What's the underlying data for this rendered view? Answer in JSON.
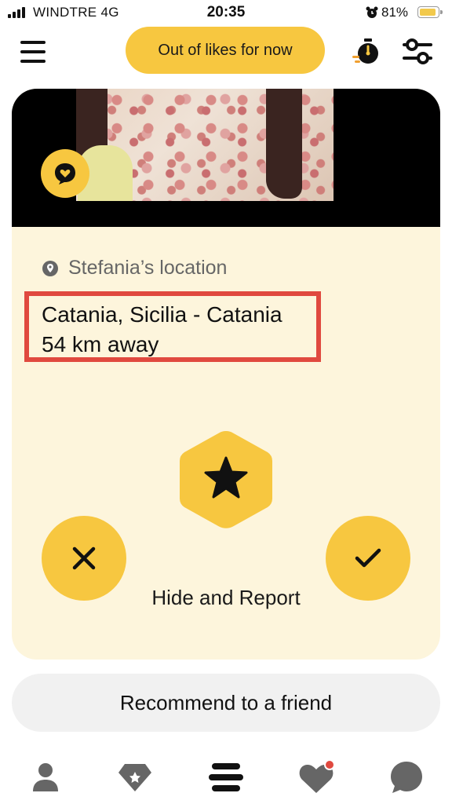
{
  "status_bar": {
    "carrier": "WINDTRE  4G",
    "time": "20:35",
    "battery": "81%",
    "battery_level": 0.81,
    "icons": [
      "signal-icon",
      "alarm-icon",
      "battery-icon"
    ]
  },
  "header": {
    "likes_button": "Out of likes for now",
    "icons": [
      "menu-icon",
      "timer-icon",
      "filter-icon"
    ]
  },
  "card": {
    "location_label": "Stefania’s location",
    "location_city": "Catania, Sicilia - Catania",
    "location_distance": "54 km away",
    "hide_report": "Hide and Report",
    "accent": "#f7c740",
    "highlight_color": "#e0493f",
    "icons": [
      "chat-bubble-icon",
      "location-pin-icon",
      "star-icon",
      "close-icon",
      "check-icon"
    ]
  },
  "recommend_button": "Recommend to a friend",
  "bottom_nav": {
    "items": [
      "profile-icon",
      "premium-diamond-icon",
      "people-icon",
      "likes-heart-icon",
      "chat-icon"
    ],
    "active": "people-icon"
  }
}
